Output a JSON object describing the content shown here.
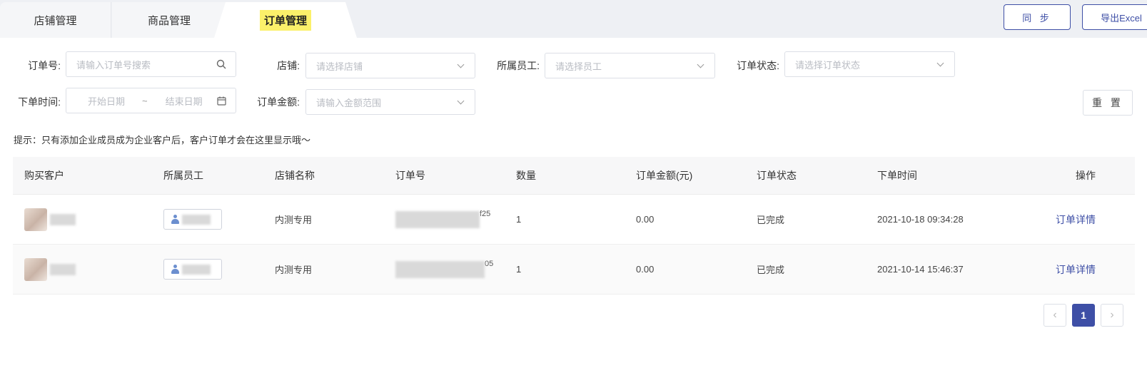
{
  "tabs": [
    {
      "label": "店铺管理"
    },
    {
      "label": "商品管理"
    },
    {
      "label": "订单管理",
      "active": true
    }
  ],
  "actions": {
    "sync_label": "同 步",
    "export_label": "导出Excel"
  },
  "filters": {
    "order_no": {
      "label": "订单号:",
      "placeholder": "请输入订单号搜索"
    },
    "store": {
      "label": "店铺:",
      "placeholder": "请选择店铺"
    },
    "staff": {
      "label": "所属员工:",
      "placeholder": "请选择员工"
    },
    "status": {
      "label": "订单状态:",
      "placeholder": "请选择订单状态"
    },
    "order_time": {
      "label": "下单时间:",
      "start_placeholder": "开始日期",
      "separator": "~",
      "end_placeholder": "结束日期"
    },
    "amount": {
      "label": "订单金额:",
      "placeholder": "请输入金额范围"
    },
    "reset_label": "重 置"
  },
  "hint": "提示：只有添加企业成员成为企业客户后，客户订单才会在这里显示哦～",
  "table": {
    "columns": [
      "购买客户",
      "所属员工",
      "店铺名称",
      "订单号",
      "数量",
      "订单金额(元)",
      "订单状态",
      "下单时间",
      "操作"
    ],
    "rows": [
      {
        "store": "内测专用",
        "order_no_suffix": "f25",
        "quantity": "1",
        "amount": "0.00",
        "status": "已完成",
        "time": "2021-10-18 09:34:28",
        "action": "订单详情"
      },
      {
        "store": "内测专用",
        "order_no_suffix": "05",
        "quantity": "1",
        "amount": "0.00",
        "status": "已完成",
        "time": "2021-10-14 15:46:37",
        "action": "订单详情"
      }
    ]
  },
  "pagination": {
    "prev": "‹",
    "current": "1",
    "next": "›"
  },
  "colors": {
    "accent": "#3e4fa6",
    "highlight": "#fbf06a"
  }
}
